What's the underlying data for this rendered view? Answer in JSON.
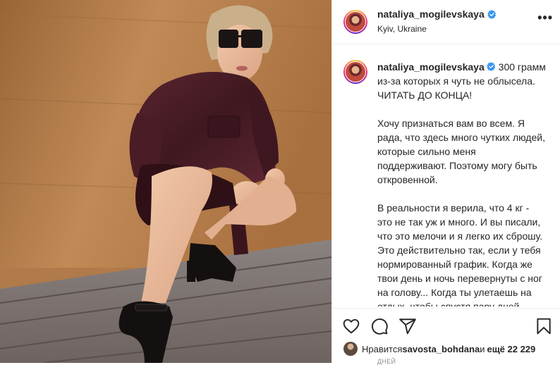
{
  "post": {
    "username": "nataliya_mogilevskaya",
    "location": "Kyiv, Ukraine",
    "more_label": "•••",
    "caption": {
      "username": "nataliya_mogilevskaya",
      "first_line": " 300 грамм из-за которых я чуть не облысела. ЧИТАТЬ ДО КОНЦА!",
      "paragraph_2": "Хочу признаться вам во всем. Я рада, что здесь много чутких людей, которые сильно меня поддерживают. Поэтому могу быть откровенной.",
      "paragraph_3": "В реальности я верила, что 4 кг - это не так уж и много. И вы писали, что это мелочи и я легко их сброшу. Это действительно так, если у тебя нормированный график. Когда же твои день и ночь перевернуты с ног на голову... Когда ты улетаешь на отдых, чтобы спустя пару дней сесть в самолёт и вернуться обратно - все"
    },
    "likes": {
      "prefix": "Нравится ",
      "user": "savosta_bohdana",
      "middle": " и ",
      "count": "ещё 22 229"
    },
    "timestamp": "ДНЕЙ"
  },
  "icons": {
    "like": "heart-icon",
    "comment": "comment-icon",
    "share": "paper-plane-icon",
    "save": "bookmark-icon",
    "verified": "verified-badge-icon"
  },
  "colors": {
    "verified_blue": "#3897f0",
    "text": "#262626",
    "secondary": "#8e8e8e",
    "border": "#efefef",
    "jacket": "#4a1c25",
    "wood_wall": "#b07a4a"
  }
}
